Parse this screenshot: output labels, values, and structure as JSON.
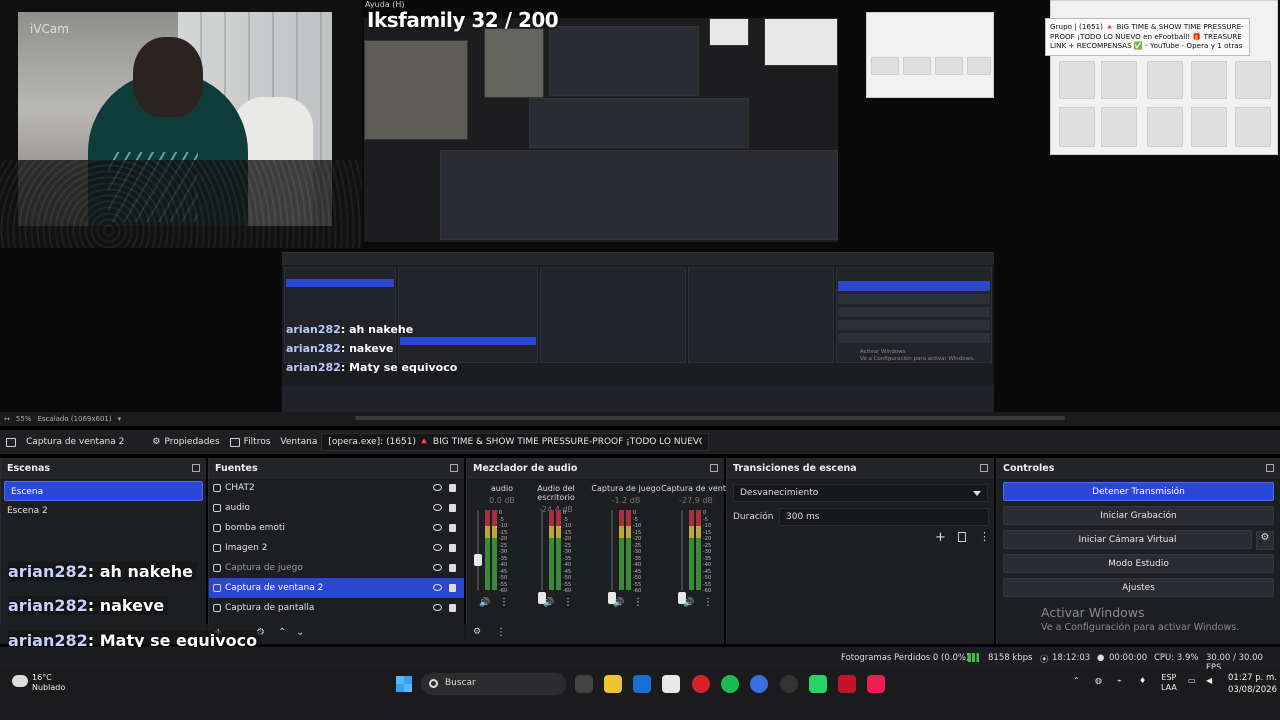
{
  "preview": {
    "cam_label": "iVCam",
    "stream_title": "Iksfamily 32 / 200",
    "menu_help": "Ayuda (H)",
    "tooltip": "Grupo | (1651) 🔺 BIG TIME & SHOW TIME PRESSURE-PROOF ¡TODO LO NUEVO en eFootball! 🎁 TREASURE LINK + RECOMPENSAS ✅ - YouTube - Opera y 1 otras",
    "inner_activate_1": "Activar Windows",
    "inner_activate_2": "Ve a Configuración para activar Windows."
  },
  "zoombar": {
    "zoom": "55%",
    "scale": "Escalado (1069x601)"
  },
  "source_toolbar": {
    "source_name": "Captura de ventana 2",
    "properties": "Propiedades",
    "filters": "Filtros",
    "window_label": "Ventana",
    "window_value": "[opera.exe]: (1651) 🔺 BIG TIME & SHOW TIME PRESSURE-PROOF ¡TODO LO NUEVO en eFootb"
  },
  "scenes": {
    "title": "Escenas",
    "items": [
      {
        "label": "Escena",
        "active": true
      },
      {
        "label": "Escena 2",
        "active": false
      }
    ]
  },
  "sources": {
    "title": "Fuentes",
    "items": [
      {
        "label": "CHAT2"
      },
      {
        "label": "audio"
      },
      {
        "label": "bomba emoti"
      },
      {
        "label": "Imagen 2"
      },
      {
        "label": "Captura de juego"
      },
      {
        "label": "Captura de ventana 2"
      },
      {
        "label": "Captura de pantalla"
      }
    ]
  },
  "mixer": {
    "title": "Mezclador de audio",
    "channels": [
      {
        "name": "audio",
        "db": "0.0 dB"
      },
      {
        "name": "Audio del escritorio",
        "db": "-24.4 dB"
      },
      {
        "name": "Captura de juego",
        "db": "-1.2 dB"
      },
      {
        "name": "Captura de venta",
        "db": "-27.9 dB"
      }
    ],
    "ticks": [
      "0",
      "-5",
      "-10",
      "-15",
      "-20",
      "-25",
      "-30",
      "-35",
      "-40",
      "-45",
      "-50",
      "-55",
      "-60"
    ]
  },
  "transitions": {
    "title": "Transiciones de escena",
    "selected": "Desvanecimiento",
    "duration_label": "Duración",
    "duration_value": "300 ms"
  },
  "controls": {
    "title": "Controles",
    "buttons": [
      "Detener Transmisión",
      "Iniciar Grabación",
      "Iniciar Cámara Virtual",
      "Modo Estudio",
      "Ajustes"
    ]
  },
  "activate_windows": {
    "line1": "Activar Windows",
    "line2": "Ve a Configuración para activar Windows."
  },
  "chat": [
    {
      "user": "arian282",
      "msg": ": ah nakehe"
    },
    {
      "user": "arian282",
      "msg": ": nakeve"
    },
    {
      "user": "arian282",
      "msg": ": Maty se equivoco"
    }
  ],
  "status": {
    "dropped": "Fotogramas Perdidos 0 (0.0%)",
    "bitrate": "8158 kbps",
    "live_time": "18:12:03",
    "rec_time": "00:00:00",
    "cpu": "CPU: 3.9%",
    "fps": "30.00 / 30.00 FPS"
  },
  "taskbar": {
    "temp": "16°C",
    "weather": "Nublado",
    "search": "Buscar",
    "lang1": "ESP",
    "lang2": "LAA",
    "time": "01:27 p. m.",
    "date": "03/08/2026"
  }
}
